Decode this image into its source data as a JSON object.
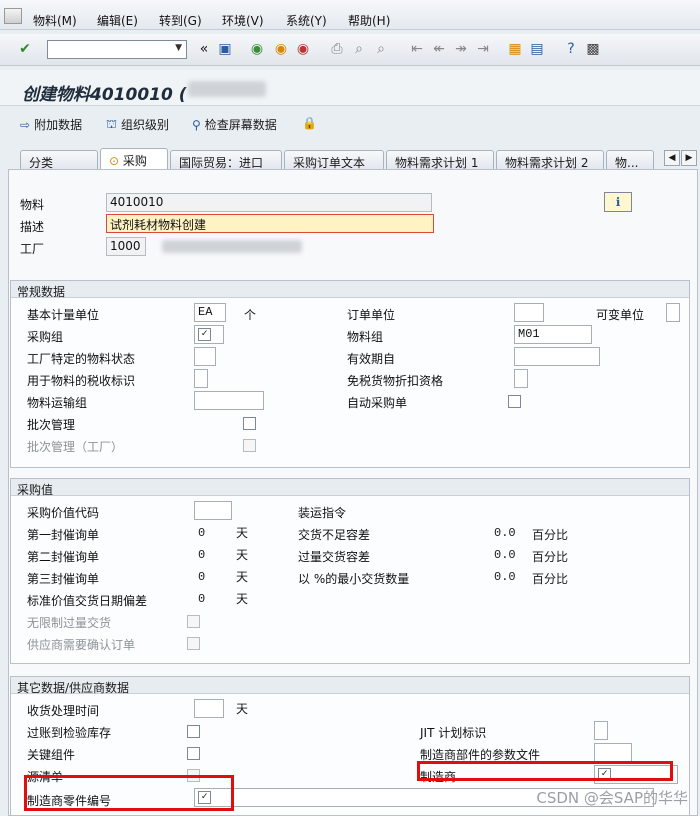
{
  "menu": [
    "物料(M)",
    "编辑(E)",
    "转到(G)",
    "环境(V)",
    "系统(Y)",
    "帮助(H)"
  ],
  "title": "创建物料4010010 (",
  "app_toolbar": [
    "附加数据",
    "组织级别",
    "检查屏幕数据"
  ],
  "tabs": [
    "分类",
    "采购",
    "国际贸易：进口",
    "采购订单文本",
    "物料需求计划 1",
    "物料需求计划 2",
    "物..."
  ],
  "header": {
    "material_label": "物料",
    "material_value": "4010010",
    "desc_label": "描述",
    "desc_value": "试剂耗材物料创建",
    "plant_label": "工厂",
    "plant_value": "1000"
  },
  "general": {
    "title": "常规数据",
    "base_uom_label": "基本计量单位",
    "base_uom_value": "EA",
    "base_uom_unit": "个",
    "order_unit_label": "订单单位",
    "var_unit_label": "可变单位",
    "purch_group_label": "采购组",
    "mat_group_label": "物料组",
    "mat_group_value": "M01",
    "plant_status_label": "工厂特定的物料状态",
    "valid_from_label": "有效期自",
    "tax_label": "用于物料的税收标识",
    "cash_disc_label": "免税货物折扣资格",
    "freight_label": "物料运输组",
    "auto_po_label": "自动采购单",
    "batch_label": "批次管理",
    "batch_plant_label": "批次管理（工厂）"
  },
  "purch_values": {
    "title": "采购值",
    "value_key_label": "采购价值代码",
    "shipping_label": "装运指令",
    "rem1_label": "第一封催询单",
    "rem1_value": "0",
    "rem1_unit": "天",
    "rem2_label": "第二封催询单",
    "rem2_value": "0",
    "rem2_unit": "天",
    "rem3_label": "第三封催询单",
    "rem3_value": "0",
    "rem3_unit": "天",
    "std_dev_label": "标准价值交货日期偏差",
    "std_dev_value": "0",
    "std_dev_unit": "天",
    "under_label": "交货不足容差",
    "under_value": "0.0",
    "under_unit": "百分比",
    "over_label": "过量交货容差",
    "over_value": "0.0",
    "over_unit": "百分比",
    "min_qty_label": "以 %的最小交货数量",
    "min_qty_value": "0.0",
    "min_qty_unit": "百分比",
    "unlimited_label": "无限制过量交货",
    "ack_label": "供应商需要确认订单"
  },
  "other": {
    "title": "其它数据/供应商数据",
    "gr_time_label": "收货处理时间",
    "gr_time_unit": "天",
    "qi_label": "过账到检验库存",
    "jit_label": "JIT 计划标识",
    "critical_label": "关键组件",
    "mpn_profile_label": "制造商部件的参数文件",
    "source_label": "源清单",
    "manufacturer_label": "制造商",
    "mpn_label": "制造商零件编号"
  },
  "checkbox_glyph": "✓",
  "watermark": "CSDN @会SAP的华华",
  "colors": {
    "highlight_red": "#e10e0e",
    "required_yellow": "#fff3c4"
  }
}
